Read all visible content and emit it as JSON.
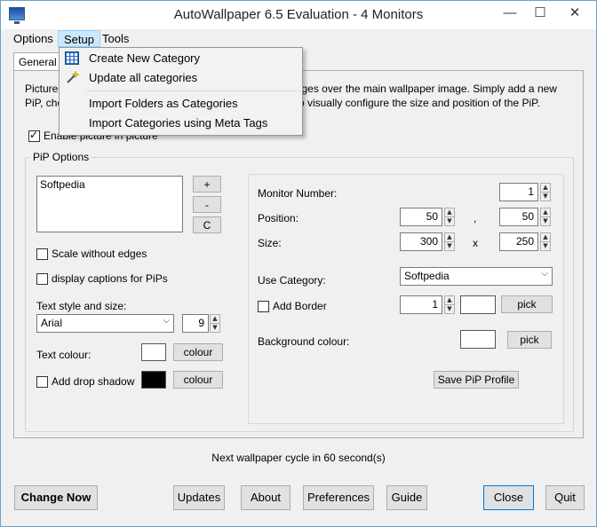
{
  "window": {
    "title": "AutoWallpaper 6.5 Evaluation - 4 Monitors"
  },
  "menubar": {
    "options": "Options",
    "setup": "Setup",
    "tools": "Tools"
  },
  "tabs": {
    "general": "General"
  },
  "description": "Picture-in-picture (PiP) allows you to display additional images over the main wallpaper image. Simply add a new PiP, choose a category and then click on the Preview tab to visually configure the size and position of the PiP.",
  "pip": {
    "enable_label": "Enable picture in picture",
    "enabled": true,
    "group_label": "PiP Options",
    "list": [
      "Softpedia"
    ],
    "add_btn": "+",
    "remove_btn": "-",
    "clear_btn": "C",
    "scale_label": "Scale without edges",
    "scale_checked": false,
    "captions_label": "display captions for PiPs",
    "captions_checked": false,
    "text_style_label": "Text style and size:",
    "font_value": "Arial",
    "font_size": "9",
    "text_colour_label": "Text colour:",
    "text_colour": "#ffffff",
    "colour_btn": "colour",
    "shadow_label": "Add drop shadow",
    "shadow_checked": false,
    "shadow_colour": "#000000"
  },
  "monitor": {
    "number_label": "Monitor Number:",
    "number": "1",
    "position_label": "Position:",
    "pos_x": "50",
    "pos_sep": ",",
    "pos_y": "50",
    "size_label": "Size:",
    "size_w": "300",
    "size_sep": "x",
    "size_h": "250",
    "category_label": "Use Category:",
    "category": "Softpedia",
    "border_label": "Add Border",
    "border_checked": false,
    "border_width": "1",
    "border_colour": "#ffffff",
    "pick_btn": "pick",
    "bg_label": "Background colour:",
    "bg_colour": "#ffffff",
    "save_btn": "Save PiP Profile"
  },
  "status": "Next wallpaper cycle in 60 second(s)",
  "footer": {
    "change_now": "Change Now",
    "updates": "Updates",
    "about": "About",
    "preferences": "Preferences",
    "guide": "Guide",
    "close": "Close",
    "quit": "Quit"
  },
  "setup_menu": {
    "items": [
      "Create New Category",
      "Update all categories",
      "Import Folders as Categories",
      "Import Categories using Meta Tags"
    ]
  }
}
